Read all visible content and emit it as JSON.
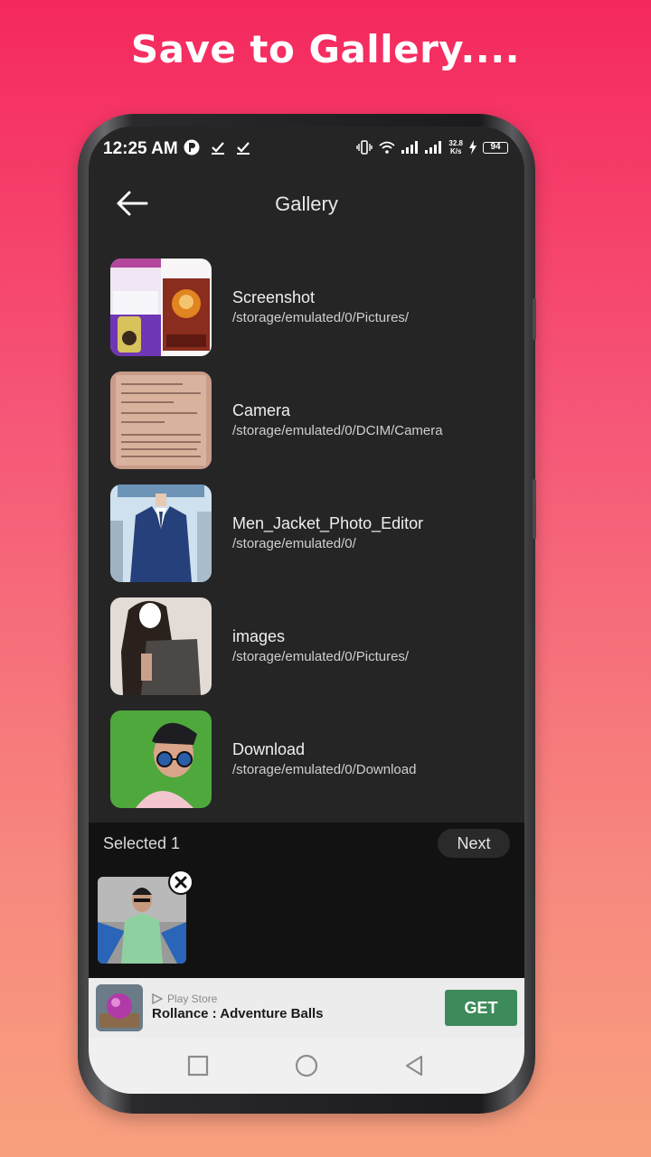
{
  "headline": "Save to Gallery....",
  "status_bar": {
    "time": "12:25 AM",
    "speed_value": "32.8",
    "speed_unit": "K/s",
    "battery": "94"
  },
  "app_bar": {
    "title": "Gallery",
    "back_icon": "arrow-left-icon"
  },
  "albums": [
    {
      "name": "Screenshot",
      "path": "/storage/emulated/0/Pictures/"
    },
    {
      "name": "Camera",
      "path": "/storage/emulated/0/DCIM/Camera"
    },
    {
      "name": "Men_Jacket_Photo_Editor",
      "path": "/storage/emulated/0/"
    },
    {
      "name": "images",
      "path": "/storage/emulated/0/Pictures/"
    },
    {
      "name": "Download",
      "path": "/storage/emulated/0/Download"
    }
  ],
  "selection": {
    "label": "Selected 1",
    "next_label": "Next",
    "remove_icon": "close-icon"
  },
  "ad": {
    "store": "Play Store",
    "title": "Rollance : Adventure Balls",
    "cta": "GET"
  },
  "nav": {
    "recents_icon": "square-icon",
    "home_icon": "circle-icon",
    "back_icon": "triangle-back-icon"
  },
  "colors": {
    "background_top": "#f5285e",
    "background_bottom": "#f8a07e",
    "screen_bg": "#252526",
    "get_button": "#3d8a5a"
  }
}
